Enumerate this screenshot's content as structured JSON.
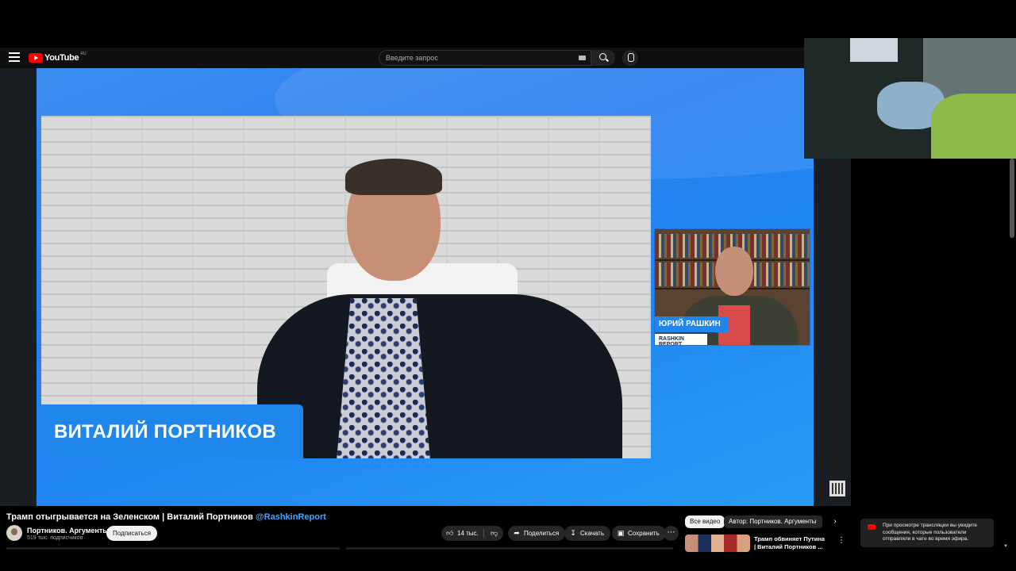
{
  "header": {
    "logo_text": "YouTube",
    "region": "RU",
    "search_placeholder": "Введите запрос"
  },
  "video": {
    "lower_third_name": "ВИТАЛИЙ ПОРТНИКОВ",
    "guest_name": "ЮРИЙ РАШКИН",
    "guest_show": "RASHKIN REPORT"
  },
  "info": {
    "title": "Трамп отыгрывается на Зеленском | Виталий Портников ",
    "mention": "@RashkinReport",
    "channel_name": "Портников. Аргументы",
    "subscribers": "519 тыс. подписчиков",
    "subscribe_label": "Подписаться"
  },
  "actions": {
    "likes": "14 тыс.",
    "share": "Поделиться",
    "download": "Скачать",
    "save": "Сохранить"
  },
  "related": {
    "chips": [
      "Все видео",
      "Автор: Портников. Аргументы"
    ],
    "item_title": "Трамп обвиняет Путина | Виталий Портников ..."
  },
  "chat_notice": "При просмотре трансляции вы увидите сообщения, которые пользователи отправляли в чате во время эфира.",
  "icons": {
    "menu": "hamburger-icon",
    "search": "search-icon",
    "mic": "mic-icon",
    "like": "thumb-up-icon",
    "dislike": "thumb-down-icon",
    "share": "share-icon",
    "download": "download-icon",
    "save": "save-icon",
    "more": "more-icon"
  },
  "colors": {
    "accent_blue": "#1f86ec",
    "youtube_red": "#ff0000",
    "mention_blue": "#3ea6ff"
  }
}
